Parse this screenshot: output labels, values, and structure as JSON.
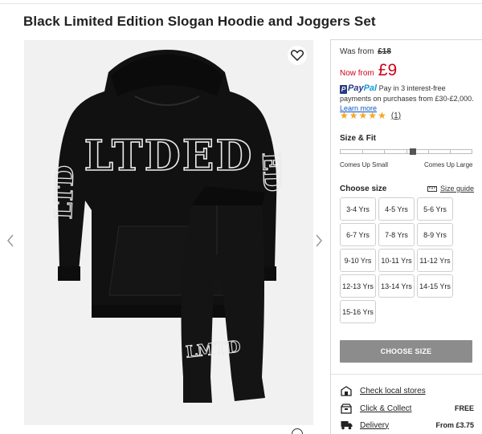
{
  "product": {
    "title": "Black Limited Edition Slogan Hoodie and Joggers Set",
    "image_alt": "Black hoodie and joggers with LIMITED print",
    "hoodie_print": "LTDED",
    "sleeve_print_left": "LTD",
    "sleeve_print_right": "ED",
    "jogger_print": "LMTD"
  },
  "price": {
    "was_label": "Was from",
    "was_value": "£18",
    "now_label": "Now from",
    "now_value": "£9"
  },
  "paypal": {
    "logo_pay": "Pay",
    "logo_pal": "Pal",
    "text": "Pay in 3 interest-free payments on purchases from £30-£2,000.",
    "learn_more": "Learn more"
  },
  "rating": {
    "stars": 5,
    "count": "(1)"
  },
  "size_fit": {
    "title": "Size & Fit",
    "low_label": "Comes Up Small",
    "high_label": "Comes Up Large",
    "segments": 6,
    "position": 0.5
  },
  "sizes": {
    "title": "Choose size",
    "guide": "Size guide",
    "options": [
      "3-4 Yrs",
      "4-5 Yrs",
      "5-6 Yrs",
      "6-7 Yrs",
      "7-8 Yrs",
      "8-9 Yrs",
      "9-10 Yrs",
      "10-11 Yrs",
      "11-12 Yrs",
      "12-13 Yrs",
      "13-14 Yrs",
      "14-15 Yrs",
      "15-16 Yrs"
    ]
  },
  "cta": {
    "choose_size": "CHOOSE SIZE"
  },
  "services": [
    {
      "icon": "store-icon",
      "label": "Check local stores",
      "value": ""
    },
    {
      "icon": "collect-icon",
      "label": "Click & Collect",
      "value": "FREE"
    },
    {
      "icon": "truck-icon",
      "label": "Delivery",
      "value": "From £3.75"
    }
  ],
  "colors": {
    "sale_red": "#d0021b",
    "star_gold": "#f5a623",
    "cta_grey": "#8c8c8c",
    "link_blue": "#0a58ca"
  }
}
